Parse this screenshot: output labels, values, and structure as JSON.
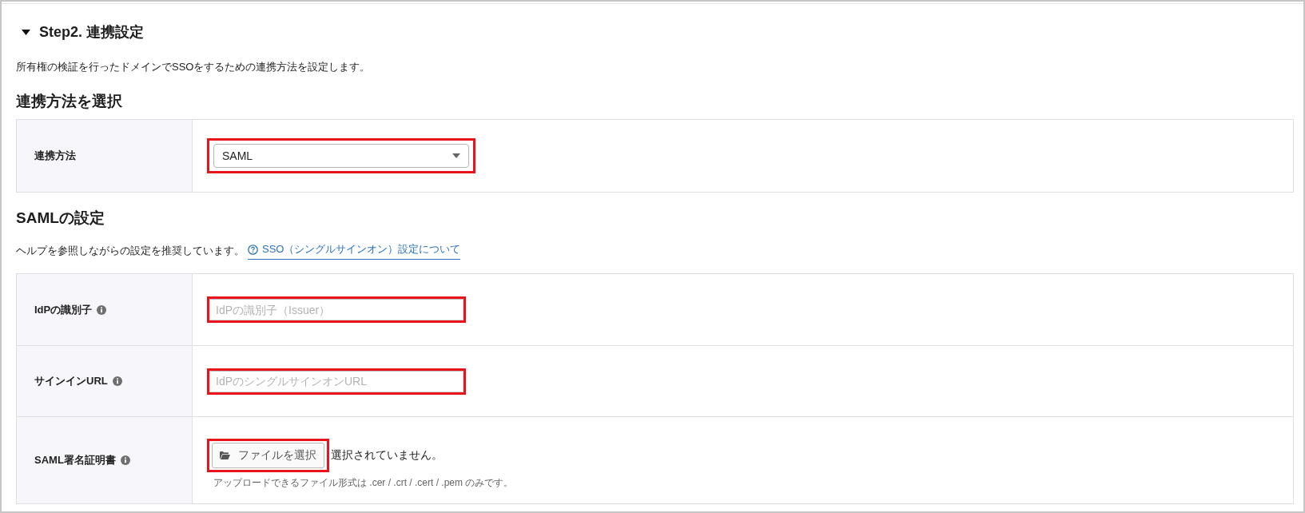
{
  "section": {
    "title": "Step2. 連携設定",
    "expanded": true,
    "description": "所有権の検証を行ったドメインでSSOをするための連携方法を設定します。"
  },
  "method": {
    "heading": "連携方法を選択",
    "rows": [
      {
        "label": "連携方法",
        "info": false,
        "kind": "select",
        "value": "SAML",
        "highlighted": true
      }
    ]
  },
  "saml": {
    "heading": "SAMLの設定",
    "help_text": "ヘルプを参照しながらの設定を推奨しています。",
    "help_link": "SSO（シングルサインオン）設定について",
    "rows": [
      {
        "label": "IdPの識別子",
        "info": true,
        "kind": "text",
        "placeholder": "IdPの識別子（Issuer）",
        "highlighted": true
      },
      {
        "label": "サインインURL",
        "info": true,
        "kind": "text",
        "placeholder": "IdPのシングルサインオンURL",
        "highlighted": true
      },
      {
        "label": "SAML署名証明書",
        "info": true,
        "kind": "file",
        "button": "ファイルを選択",
        "status": "選択されていません。",
        "hint": "アップロードできるファイル形式は .cer / .crt / .cert / .pem のみです。",
        "highlighted": true
      }
    ]
  }
}
